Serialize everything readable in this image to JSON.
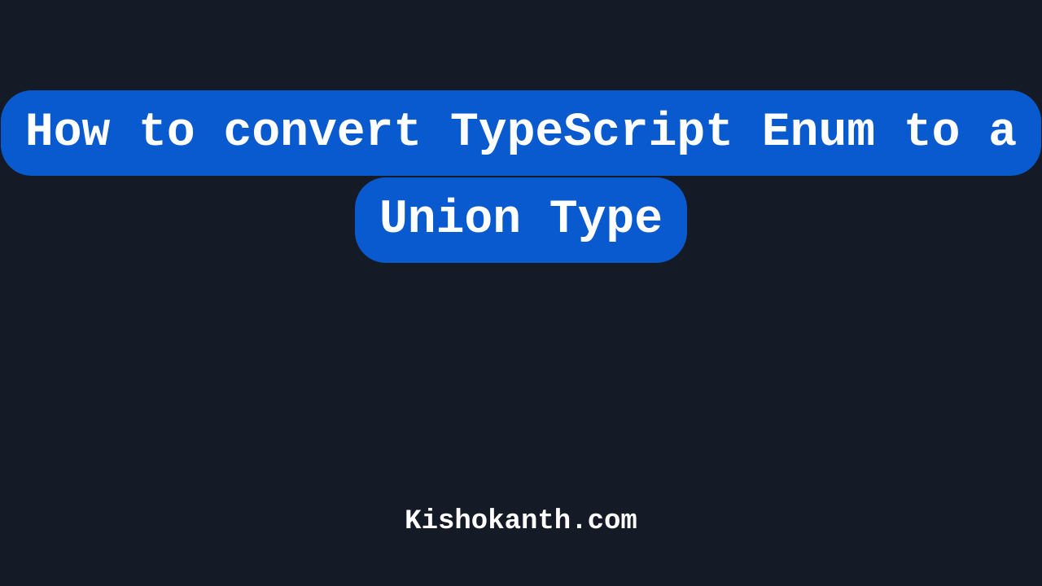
{
  "title": "How to convert TypeScript Enum to a Union Type",
  "siteName": "Kishokanth.com"
}
